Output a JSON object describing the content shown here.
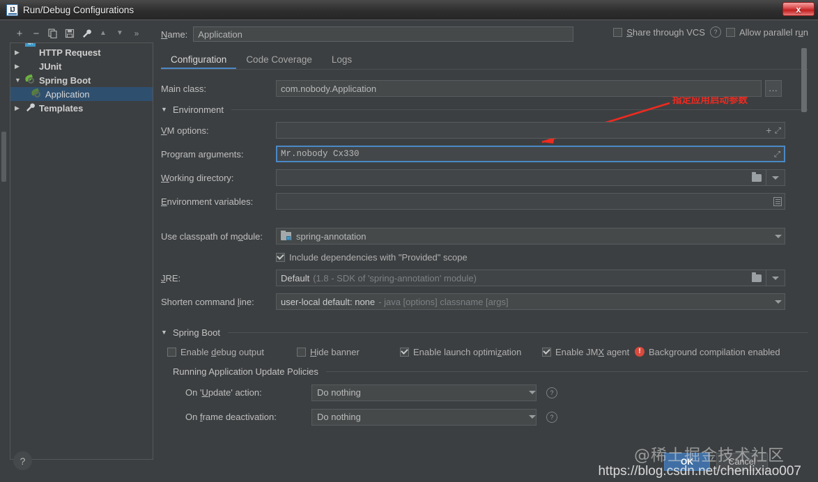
{
  "window": {
    "title": "Run/Debug Configurations",
    "logo_text": "IJ",
    "close_label": "x"
  },
  "toolbar": {
    "add": "+",
    "remove": "−",
    "copy": "copy",
    "save": "save",
    "settings": "wrench",
    "move_up": "▲",
    "move_down": "▼",
    "more": "»"
  },
  "tree": {
    "items": [
      {
        "label": "HTTP Request",
        "icon": "http-request-icon",
        "triangle": "▶",
        "indent": "root",
        "selected": false
      },
      {
        "label": "JUnit",
        "icon": "junit-icon",
        "triangle": "▶",
        "indent": "root",
        "selected": false
      },
      {
        "label": "Spring Boot",
        "icon": "spring-boot-icon",
        "triangle": "▼",
        "indent": "root",
        "selected": false
      },
      {
        "label": "Application",
        "icon": "spring-boot-icon",
        "triangle": "",
        "indent": "child",
        "selected": true
      },
      {
        "label": "Templates",
        "icon": "templates-icon",
        "triangle": "▶",
        "indent": "root",
        "selected": false
      }
    ]
  },
  "header": {
    "name_label": "Name:",
    "name_underline": "N",
    "name_value": "Application",
    "share_vcs_label": "Share through VCS",
    "share_vcs_underline": "S",
    "share_vcs_checked": false,
    "allow_parallel_label": "Allow parallel run",
    "allow_parallel_underline": "u",
    "allow_parallel_checked": false,
    "help_glyph": "?"
  },
  "tabs": [
    {
      "label": "Configuration",
      "active": true
    },
    {
      "label": "Code Coverage",
      "active": false
    },
    {
      "label": "Logs",
      "active": false
    }
  ],
  "form": {
    "main_class": {
      "label": "Main class:",
      "value": "com.nobody.Application",
      "browse_label": "..."
    },
    "environment_section": "Environment",
    "vm_options": {
      "label": "VM options:",
      "label_underline": "V",
      "value": "",
      "macro_glyph": "+",
      "expand_glyph": "⤡"
    },
    "program_arguments": {
      "label": "Program arguments:",
      "label_underline": "g",
      "value": "Mr.nobody Cx330",
      "focused": true,
      "expand_glyph": "⤡"
    },
    "working_directory": {
      "label": "Working directory:",
      "label_underline": "W",
      "value": "",
      "folder_glyph": "folder",
      "dropdown_glyph": "▼"
    },
    "environment_variables": {
      "label": "Environment variables:",
      "label_underline": "E",
      "value": "",
      "list_glyph": "list"
    },
    "use_classpath": {
      "label": "Use classpath of module:",
      "label_underline": "o",
      "value": "spring-annotation",
      "icon": "module-icon",
      "dropdown_glyph": "▼"
    },
    "include_provided": {
      "label": "Include dependencies with \"Provided\" scope",
      "checked": true
    },
    "jre": {
      "label": "JRE:",
      "label_underline": "J",
      "value_primary": "Default",
      "value_secondary": "(1.8 - SDK of 'spring-annotation' module)",
      "folder_glyph": "folder",
      "dropdown_glyph": "▼"
    },
    "shorten_command_line": {
      "label": "Shorten command line:",
      "label_underline": "l",
      "value_primary": "user-local default: none",
      "value_secondary": "- java [options] classname [args]",
      "dropdown_glyph": "▼"
    }
  },
  "spring_boot": {
    "section_label": "Spring Boot",
    "checkboxes": [
      {
        "label": "Enable debug output",
        "underline": "d",
        "checked": false
      },
      {
        "label": "Hide banner",
        "underline": "H",
        "checked": false
      },
      {
        "label": "Enable launch optimization",
        "underline": "z",
        "checked": true
      },
      {
        "label": "Enable JMX agent",
        "underline": "X",
        "checked": true
      }
    ],
    "warning": {
      "icon": "warning-icon",
      "glyph": "!",
      "text": "Background compilation enabled",
      "color": "#d94a3d"
    },
    "update_policies_section": "Running Application Update Policies",
    "on_update": {
      "label": "On 'Update' action:",
      "label_underline": "U",
      "value": "Do nothing",
      "dropdown_glyph": "▼",
      "help_glyph": "?"
    },
    "on_frame_deactivation": {
      "label": "On frame deactivation:",
      "label_underline": "f",
      "value": "Do nothing",
      "dropdown_glyph": "▼",
      "help_glyph": "?"
    }
  },
  "annotation": {
    "text": "指定应用启动参数",
    "color": "#ee2a20"
  },
  "footer": {
    "help_glyph": "?",
    "ok_label": "OK",
    "cancel_label": "Cancel"
  },
  "watermarks": {
    "community": "@稀土掘金技术社区",
    "url": "https://blog.csdn.net/chenlixiao007"
  }
}
